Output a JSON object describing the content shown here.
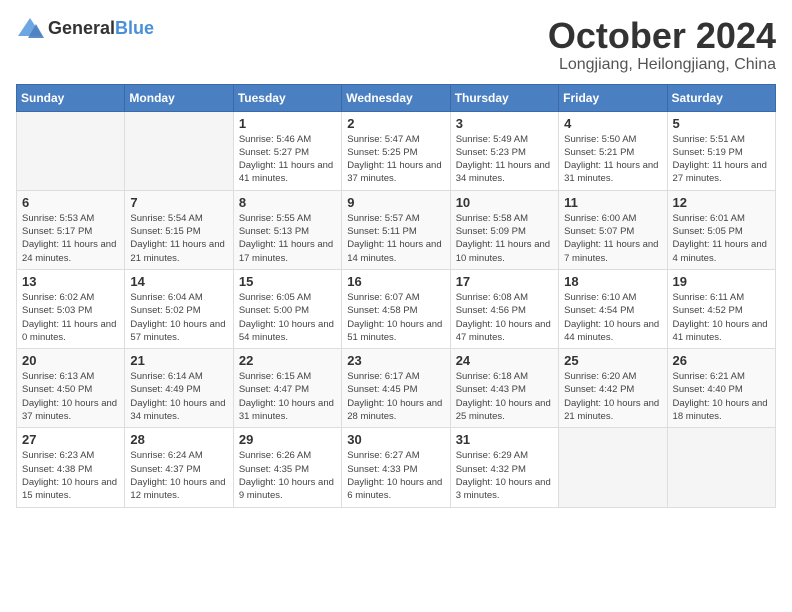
{
  "header": {
    "logo_general": "General",
    "logo_blue": "Blue",
    "month": "October 2024",
    "location": "Longjiang, Heilongjiang, China"
  },
  "weekdays": [
    "Sunday",
    "Monday",
    "Tuesday",
    "Wednesday",
    "Thursday",
    "Friday",
    "Saturday"
  ],
  "weeks": [
    [
      {
        "day": "",
        "sunrise": "",
        "sunset": "",
        "daylight": ""
      },
      {
        "day": "",
        "sunrise": "",
        "sunset": "",
        "daylight": ""
      },
      {
        "day": "1",
        "sunrise": "Sunrise: 5:46 AM",
        "sunset": "Sunset: 5:27 PM",
        "daylight": "Daylight: 11 hours and 41 minutes."
      },
      {
        "day": "2",
        "sunrise": "Sunrise: 5:47 AM",
        "sunset": "Sunset: 5:25 PM",
        "daylight": "Daylight: 11 hours and 37 minutes."
      },
      {
        "day": "3",
        "sunrise": "Sunrise: 5:49 AM",
        "sunset": "Sunset: 5:23 PM",
        "daylight": "Daylight: 11 hours and 34 minutes."
      },
      {
        "day": "4",
        "sunrise": "Sunrise: 5:50 AM",
        "sunset": "Sunset: 5:21 PM",
        "daylight": "Daylight: 11 hours and 31 minutes."
      },
      {
        "day": "5",
        "sunrise": "Sunrise: 5:51 AM",
        "sunset": "Sunset: 5:19 PM",
        "daylight": "Daylight: 11 hours and 27 minutes."
      }
    ],
    [
      {
        "day": "6",
        "sunrise": "Sunrise: 5:53 AM",
        "sunset": "Sunset: 5:17 PM",
        "daylight": "Daylight: 11 hours and 24 minutes."
      },
      {
        "day": "7",
        "sunrise": "Sunrise: 5:54 AM",
        "sunset": "Sunset: 5:15 PM",
        "daylight": "Daylight: 11 hours and 21 minutes."
      },
      {
        "day": "8",
        "sunrise": "Sunrise: 5:55 AM",
        "sunset": "Sunset: 5:13 PM",
        "daylight": "Daylight: 11 hours and 17 minutes."
      },
      {
        "day": "9",
        "sunrise": "Sunrise: 5:57 AM",
        "sunset": "Sunset: 5:11 PM",
        "daylight": "Daylight: 11 hours and 14 minutes."
      },
      {
        "day": "10",
        "sunrise": "Sunrise: 5:58 AM",
        "sunset": "Sunset: 5:09 PM",
        "daylight": "Daylight: 11 hours and 10 minutes."
      },
      {
        "day": "11",
        "sunrise": "Sunrise: 6:00 AM",
        "sunset": "Sunset: 5:07 PM",
        "daylight": "Daylight: 11 hours and 7 minutes."
      },
      {
        "day": "12",
        "sunrise": "Sunrise: 6:01 AM",
        "sunset": "Sunset: 5:05 PM",
        "daylight": "Daylight: 11 hours and 4 minutes."
      }
    ],
    [
      {
        "day": "13",
        "sunrise": "Sunrise: 6:02 AM",
        "sunset": "Sunset: 5:03 PM",
        "daylight": "Daylight: 11 hours and 0 minutes."
      },
      {
        "day": "14",
        "sunrise": "Sunrise: 6:04 AM",
        "sunset": "Sunset: 5:02 PM",
        "daylight": "Daylight: 10 hours and 57 minutes."
      },
      {
        "day": "15",
        "sunrise": "Sunrise: 6:05 AM",
        "sunset": "Sunset: 5:00 PM",
        "daylight": "Daylight: 10 hours and 54 minutes."
      },
      {
        "day": "16",
        "sunrise": "Sunrise: 6:07 AM",
        "sunset": "Sunset: 4:58 PM",
        "daylight": "Daylight: 10 hours and 51 minutes."
      },
      {
        "day": "17",
        "sunrise": "Sunrise: 6:08 AM",
        "sunset": "Sunset: 4:56 PM",
        "daylight": "Daylight: 10 hours and 47 minutes."
      },
      {
        "day": "18",
        "sunrise": "Sunrise: 6:10 AM",
        "sunset": "Sunset: 4:54 PM",
        "daylight": "Daylight: 10 hours and 44 minutes."
      },
      {
        "day": "19",
        "sunrise": "Sunrise: 6:11 AM",
        "sunset": "Sunset: 4:52 PM",
        "daylight": "Daylight: 10 hours and 41 minutes."
      }
    ],
    [
      {
        "day": "20",
        "sunrise": "Sunrise: 6:13 AM",
        "sunset": "Sunset: 4:50 PM",
        "daylight": "Daylight: 10 hours and 37 minutes."
      },
      {
        "day": "21",
        "sunrise": "Sunrise: 6:14 AM",
        "sunset": "Sunset: 4:49 PM",
        "daylight": "Daylight: 10 hours and 34 minutes."
      },
      {
        "day": "22",
        "sunrise": "Sunrise: 6:15 AM",
        "sunset": "Sunset: 4:47 PM",
        "daylight": "Daylight: 10 hours and 31 minutes."
      },
      {
        "day": "23",
        "sunrise": "Sunrise: 6:17 AM",
        "sunset": "Sunset: 4:45 PM",
        "daylight": "Daylight: 10 hours and 28 minutes."
      },
      {
        "day": "24",
        "sunrise": "Sunrise: 6:18 AM",
        "sunset": "Sunset: 4:43 PM",
        "daylight": "Daylight: 10 hours and 25 minutes."
      },
      {
        "day": "25",
        "sunrise": "Sunrise: 6:20 AM",
        "sunset": "Sunset: 4:42 PM",
        "daylight": "Daylight: 10 hours and 21 minutes."
      },
      {
        "day": "26",
        "sunrise": "Sunrise: 6:21 AM",
        "sunset": "Sunset: 4:40 PM",
        "daylight": "Daylight: 10 hours and 18 minutes."
      }
    ],
    [
      {
        "day": "27",
        "sunrise": "Sunrise: 6:23 AM",
        "sunset": "Sunset: 4:38 PM",
        "daylight": "Daylight: 10 hours and 15 minutes."
      },
      {
        "day": "28",
        "sunrise": "Sunrise: 6:24 AM",
        "sunset": "Sunset: 4:37 PM",
        "daylight": "Daylight: 10 hours and 12 minutes."
      },
      {
        "day": "29",
        "sunrise": "Sunrise: 6:26 AM",
        "sunset": "Sunset: 4:35 PM",
        "daylight": "Daylight: 10 hours and 9 minutes."
      },
      {
        "day": "30",
        "sunrise": "Sunrise: 6:27 AM",
        "sunset": "Sunset: 4:33 PM",
        "daylight": "Daylight: 10 hours and 6 minutes."
      },
      {
        "day": "31",
        "sunrise": "Sunrise: 6:29 AM",
        "sunset": "Sunset: 4:32 PM",
        "daylight": "Daylight: 10 hours and 3 minutes."
      },
      {
        "day": "",
        "sunrise": "",
        "sunset": "",
        "daylight": ""
      },
      {
        "day": "",
        "sunrise": "",
        "sunset": "",
        "daylight": ""
      }
    ]
  ]
}
